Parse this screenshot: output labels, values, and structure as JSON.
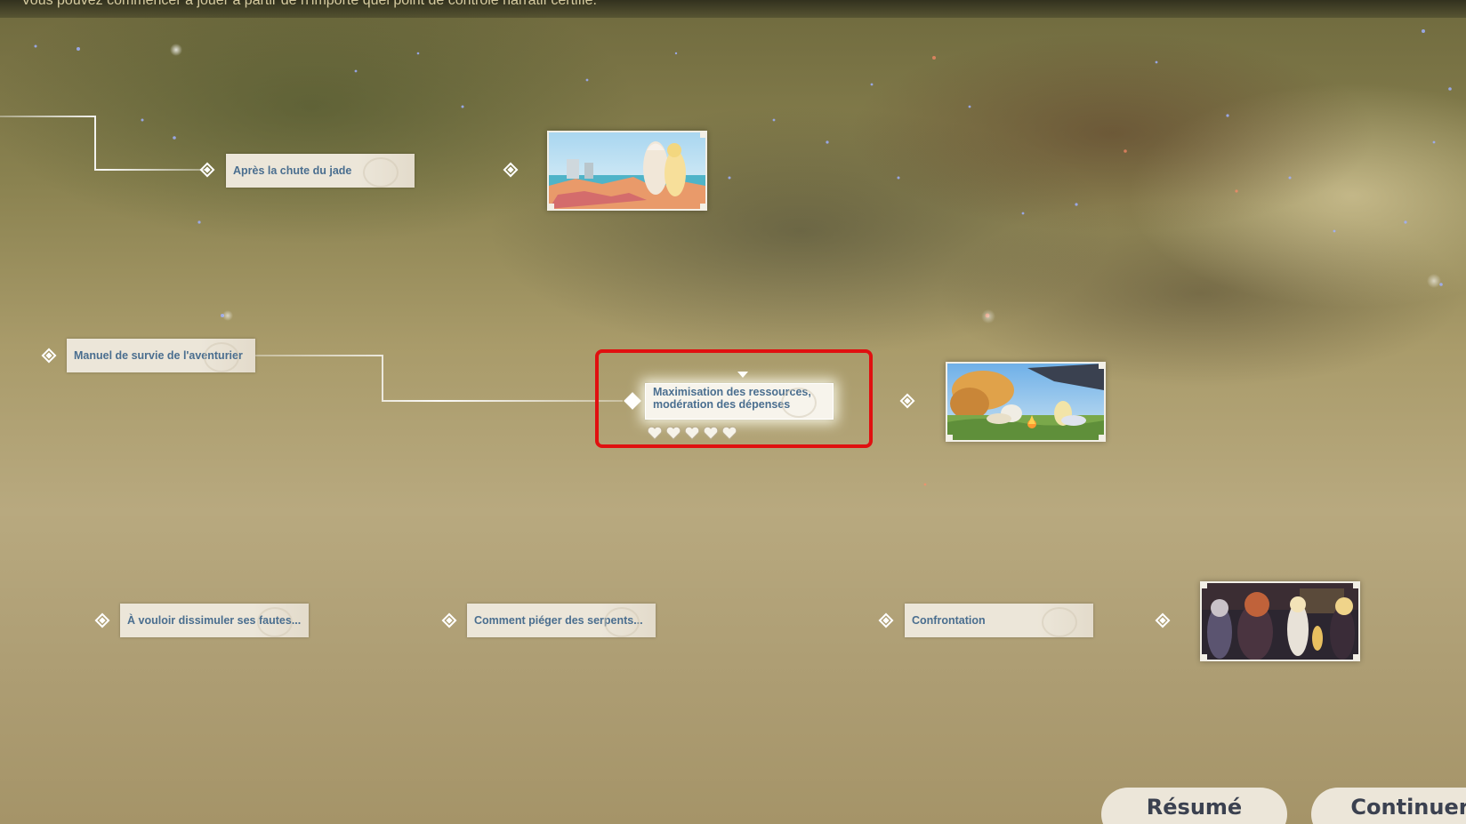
{
  "header": {
    "hint": "Vous pouvez commencer à jouer à partir de n'importe quel point de contrôle narratif certifié."
  },
  "branches": [
    {
      "row": "top",
      "nodes": [
        {
          "label": "Après la chute du jade",
          "active": false
        }
      ],
      "thumbnail": {
        "scene": "coastal-town-scene"
      }
    },
    {
      "row": "middle",
      "nodes": [
        {
          "label": "Manuel de survie de l'aventurier",
          "active": false
        },
        {
          "label_line1": "Maximisation des ressources,",
          "label_line2": "modération des dépenses",
          "active": true,
          "hearts_filled": 0,
          "hearts_total": 5
        }
      ],
      "thumbnail": {
        "scene": "campfire-scene"
      }
    },
    {
      "row": "bottom",
      "nodes": [
        {
          "label": "À vouloir dissimuler ses fautes...",
          "active": false
        },
        {
          "label": "Comment piéger des serpents...",
          "active": false
        },
        {
          "label": "Confrontation",
          "active": false
        }
      ],
      "thumbnail": {
        "scene": "confrontation-scene"
      }
    }
  ],
  "buttons": {
    "summary": "Résumé",
    "continue": "Continuer"
  },
  "colors": {
    "node_text": "#4a6e8f",
    "node_bg": "#ece6d9",
    "highlight": "#e01010",
    "button_text": "#3b4150"
  }
}
